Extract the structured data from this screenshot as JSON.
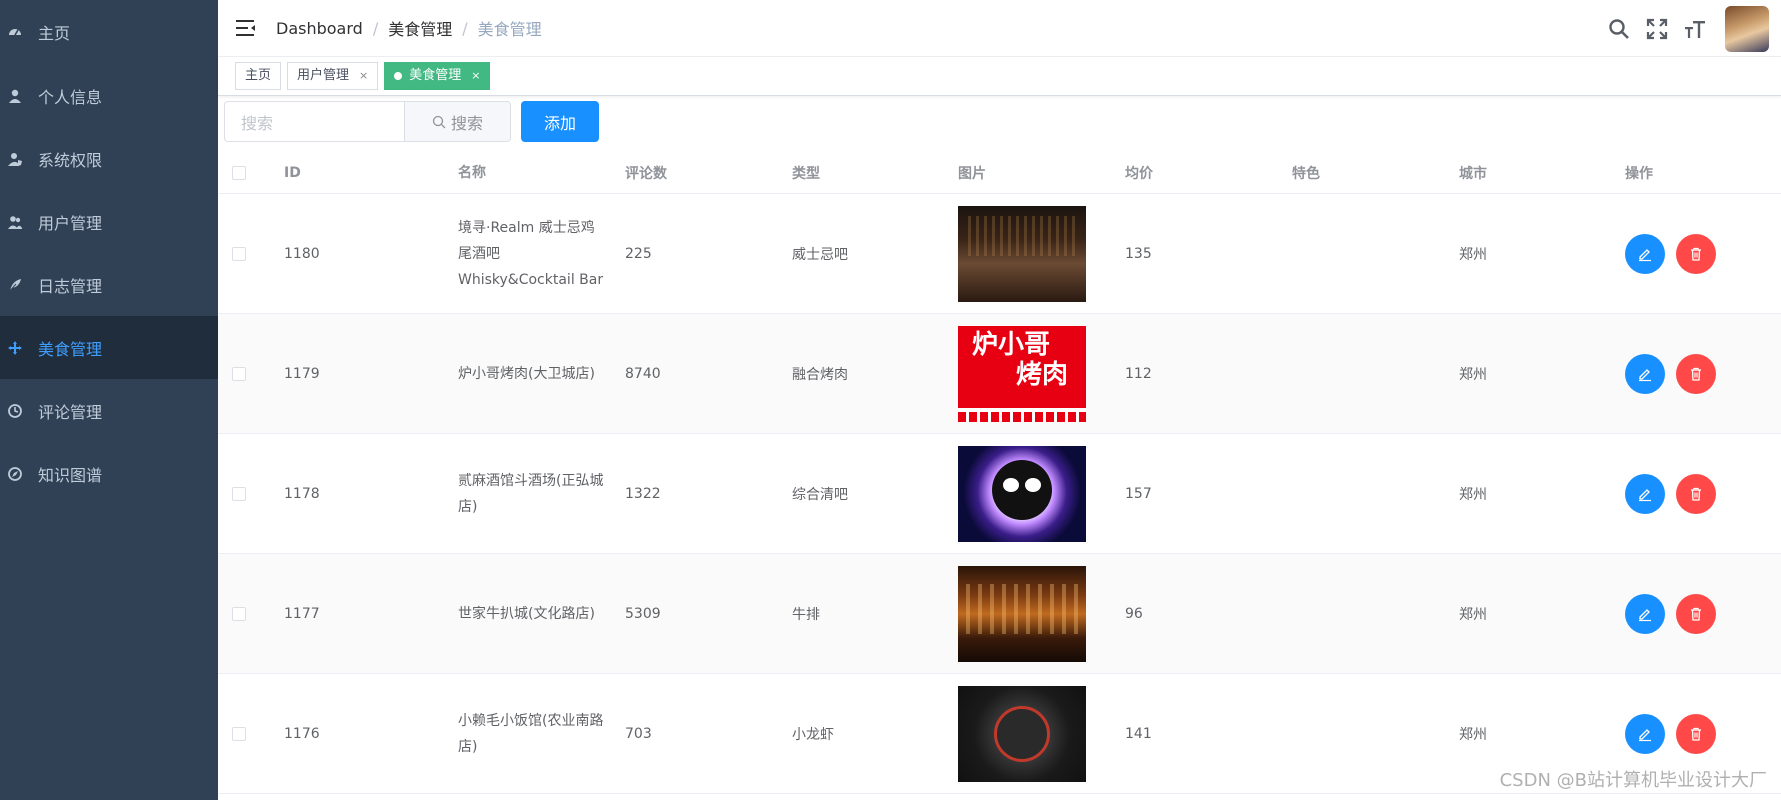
{
  "sidebar": {
    "items": [
      {
        "label": "主页",
        "icon": "dashboard-icon",
        "active": false
      },
      {
        "label": "个人信息",
        "icon": "user-icon",
        "active": false
      },
      {
        "label": "系统权限",
        "icon": "user-shield-icon",
        "active": false
      },
      {
        "label": "用户管理",
        "icon": "users-icon",
        "active": false
      },
      {
        "label": "日志管理",
        "icon": "feather-icon",
        "active": false
      },
      {
        "label": "美食管理",
        "icon": "move-icon",
        "active": true
      },
      {
        "label": "评论管理",
        "icon": "clock-icon",
        "active": false
      },
      {
        "label": "知识图谱",
        "icon": "compass-icon",
        "active": false
      }
    ]
  },
  "navbar": {
    "breadcrumb": [
      "Dashboard",
      "美食管理",
      "美食管理"
    ]
  },
  "tags": [
    {
      "label": "主页",
      "closable": false,
      "active": false
    },
    {
      "label": "用户管理",
      "closable": true,
      "active": false
    },
    {
      "label": "美食管理",
      "closable": true,
      "active": true
    }
  ],
  "toolbar": {
    "search_placeholder": "搜索",
    "search_button": "搜索",
    "add_button": "添加"
  },
  "table": {
    "headers": [
      "ID",
      "名称",
      "评论数",
      "类型",
      "图片",
      "均价",
      "特色",
      "城市",
      "操作"
    ],
    "rows": [
      {
        "id": "1180",
        "name": "境寻·Realm 威士忌鸡尾酒吧 Whisky&Cocktail Bar",
        "comments": "225",
        "type": "威士忌吧",
        "image": "bar-interior-photo",
        "avg": "135",
        "feature": "",
        "city": "郑州"
      },
      {
        "id": "1179",
        "name": "炉小哥烤肉(大卫城店)",
        "comments": "8740",
        "type": "融合烤肉",
        "image": "luxiaoge-logo",
        "avg": "112",
        "feature": "",
        "city": "郑州"
      },
      {
        "id": "1178",
        "name": "贰麻酒馆斗酒场(正弘城店)",
        "comments": "1322",
        "type": "综合清吧",
        "image": "panda-neon-logo",
        "avg": "157",
        "feature": "",
        "city": "郑州"
      },
      {
        "id": "1177",
        "name": "世家牛扒城(文化路店)",
        "comments": "5309",
        "type": "牛排",
        "image": "restaurant-facade-photo",
        "avg": "96",
        "feature": "",
        "city": "郑州"
      },
      {
        "id": "1176",
        "name": "小赖毛小饭馆(农业南路店)",
        "comments": "703",
        "type": "小龙虾",
        "image": "crayfish-logo",
        "avg": "141",
        "feature": "",
        "city": "郑州"
      }
    ]
  },
  "thumb2_text": [
    "炉小哥",
    "烤肉"
  ],
  "watermark": "CSDN @B站计算机毕业设计大厂",
  "colors": {
    "sidebar_bg": "#304156",
    "active": "#409eff",
    "tag_active": "#42b983",
    "edit": "#1890ff",
    "delete": "#ff4949"
  }
}
